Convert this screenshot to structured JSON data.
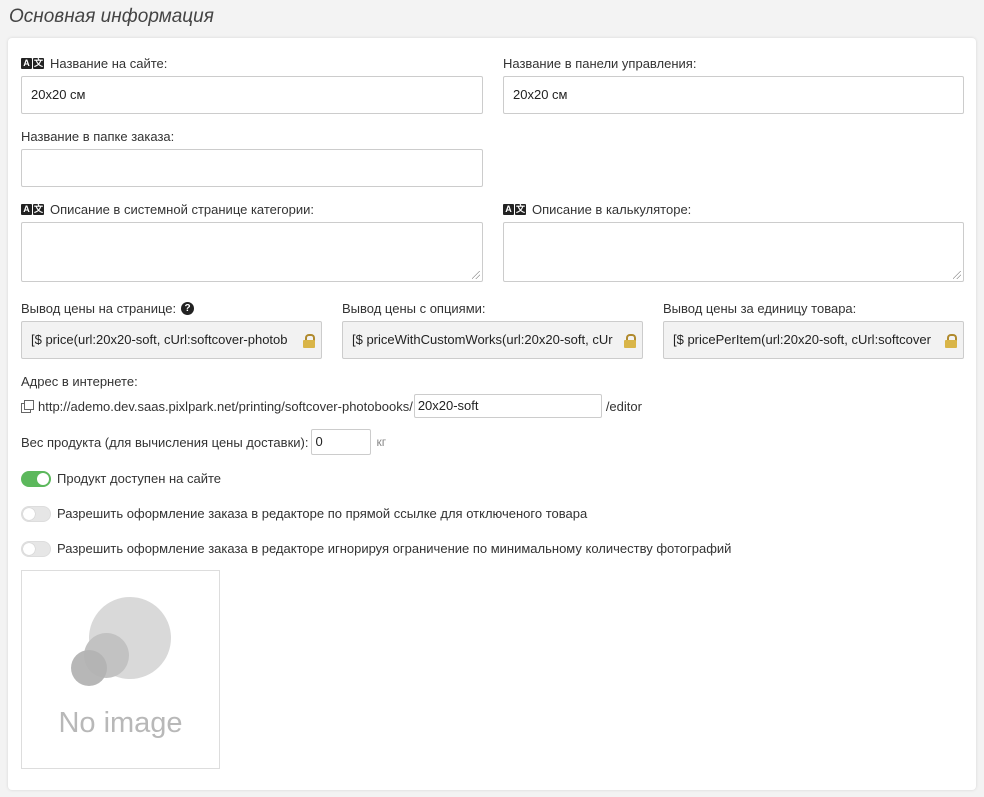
{
  "section": {
    "title": "Основная информация"
  },
  "fields": {
    "site_name": {
      "label": "Название на сайте:",
      "value": "20x20 см",
      "translatable": true
    },
    "admin_name": {
      "label": "Название в панели управления:",
      "value": "20x20 см"
    },
    "order_folder_name": {
      "label": "Название в папке заказа:",
      "value": ""
    },
    "category_description": {
      "label": "Описание в системной странице категории:",
      "value": "",
      "translatable": true
    },
    "calculator_description": {
      "label": "Описание в калькуляторе:",
      "value": "",
      "translatable": true
    },
    "price_output": {
      "label": "Вывод цены на странице:",
      "value": "[$ price(url:20x20-soft, cUrl:softcover-photob"
    },
    "price_with_options": {
      "label": "Вывод цены с опциями:",
      "value": "[$ priceWithCustomWorks(url:20x20-soft, cUr"
    },
    "price_per_item": {
      "label": "Вывод цены за единицу товара:",
      "value": "[$ pricePerItem(url:20x20-soft, cUrl:softcover"
    },
    "internet_address": {
      "label": "Адрес в интернете:",
      "base_url": "http://ademo.dev.saas.pixlpark.net/printing/softcover-photobooks/",
      "slug": "20x20-soft",
      "suffix": "/editor"
    },
    "weight": {
      "label": "Вес продукта (для вычисления цены доставки):",
      "value": "0",
      "unit": "кг"
    }
  },
  "toggles": [
    {
      "label": "Продукт доступен на сайте",
      "on": true
    },
    {
      "label": "Разрешить оформление заказа в редакторе по прямой ссылке для отключеного товара",
      "on": false
    },
    {
      "label": "Разрешить оформление заказа в редакторе игнорируя ограничение по минимальному количеству фотографий",
      "on": false
    }
  ],
  "image": {
    "placeholder_text": "No image"
  },
  "icons": {
    "translate": "translate-icon",
    "help": "question-circle-icon",
    "lock": "lock-icon",
    "external_link": "external-link-icon"
  },
  "colors": {
    "toggle_on": "#5cb85c",
    "readonly_bg": "#f2f2f2"
  }
}
